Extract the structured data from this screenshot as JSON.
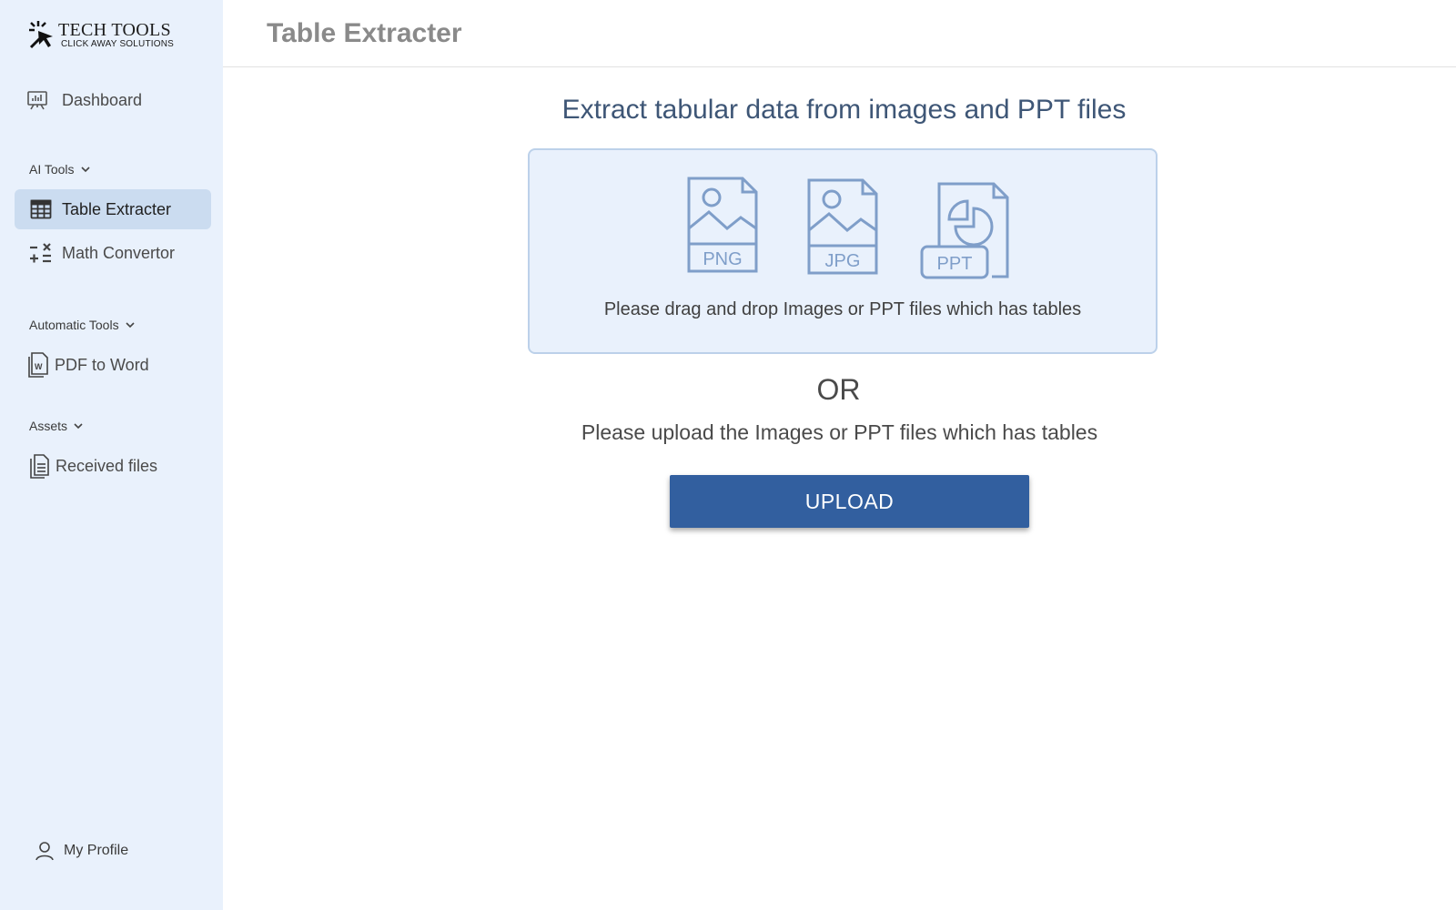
{
  "brand": {
    "title": "TECH TOOLS",
    "subtitle": "CLICK AWAY SOLUTIONS"
  },
  "sidebar": {
    "dashboard": {
      "label": "Dashboard",
      "icon": "presentation-chart-icon"
    },
    "sections": [
      {
        "label": "AI Tools",
        "items": [
          {
            "label": "Table Extracter",
            "icon": "table-icon",
            "active": true
          },
          {
            "label": "Math Convertor",
            "icon": "calculator-symbols-icon",
            "active": false
          }
        ]
      },
      {
        "label": "Automatic Tools",
        "items": [
          {
            "label": "PDF to Word",
            "icon": "word-document-icon",
            "active": false
          }
        ]
      },
      {
        "label": "Assets",
        "items": [
          {
            "label": "Received files",
            "icon": "files-icon",
            "active": false
          }
        ]
      }
    ],
    "profile": {
      "label": "My Profile",
      "icon": "user-icon"
    }
  },
  "header": {
    "title": "Table Extracter"
  },
  "main": {
    "headline": "Extract tabular data from images and PPT files",
    "dropzone": {
      "file_types": [
        "PNG",
        "JPG",
        "PPT"
      ],
      "text": "Please drag and drop Images or PPT files which has tables"
    },
    "or_label": "OR",
    "upload_text": "Please upload the Images or PPT files which has tables",
    "upload_button": "UPLOAD"
  },
  "colors": {
    "sidebar_bg": "#e9f1fc",
    "active_item_bg": "#cbdcf0",
    "headline": "#3e5676",
    "icon_blue": "#7f9ec9",
    "button": "#325f9f"
  }
}
